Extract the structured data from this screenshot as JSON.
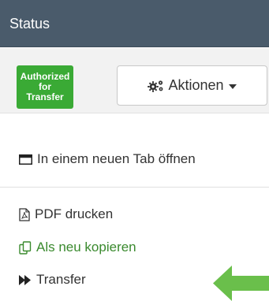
{
  "header": {
    "title": "Status"
  },
  "toolbar": {
    "badge_lines": [
      "Authorized",
      "for",
      "Transfer"
    ],
    "actions_label": "Aktionen"
  },
  "menu": {
    "open_new_tab": "In einem neuen Tab öffnen",
    "print_pdf": "PDF drucken",
    "copy_as_new": "Als neu kopieren",
    "transfer": "Transfer"
  },
  "colors": {
    "header_bg": "#4a5b6b",
    "badge_bg": "#3aaa35",
    "copy_link": "#3a8a2e",
    "arrow": "#6abf4b"
  }
}
